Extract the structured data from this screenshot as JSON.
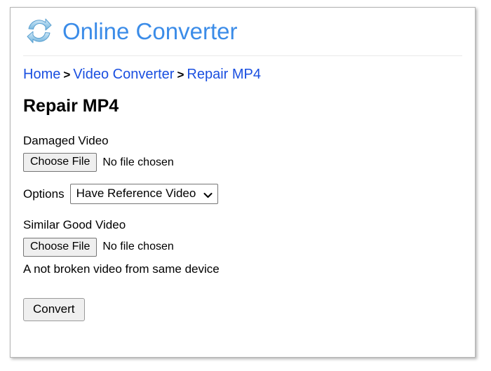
{
  "site": {
    "logo_icon": "refresh-convert-arrows-icon",
    "name": "Online Converter",
    "brand_color": "#3b8ce8"
  },
  "breadcrumb": {
    "separator": ">",
    "items": [
      {
        "label": "Home",
        "is_link": true
      },
      {
        "label": "Video Converter",
        "is_link": true
      },
      {
        "label": "Repair MP4",
        "is_link": true
      }
    ],
    "link_color": "#1a4fe0"
  },
  "page": {
    "title": "Repair MP4"
  },
  "form": {
    "damaged_video": {
      "label": "Damaged Video",
      "button_label": "Choose File",
      "file_status": "No file chosen"
    },
    "options": {
      "label": "Options",
      "selected": "Have Reference Video",
      "chevron_icon": "chevron-down-icon"
    },
    "similar_good_video": {
      "label": "Similar Good Video",
      "button_label": "Choose File",
      "file_status": "No file chosen",
      "hint": "A not broken video from same device"
    },
    "submit": {
      "label": "Convert"
    }
  }
}
